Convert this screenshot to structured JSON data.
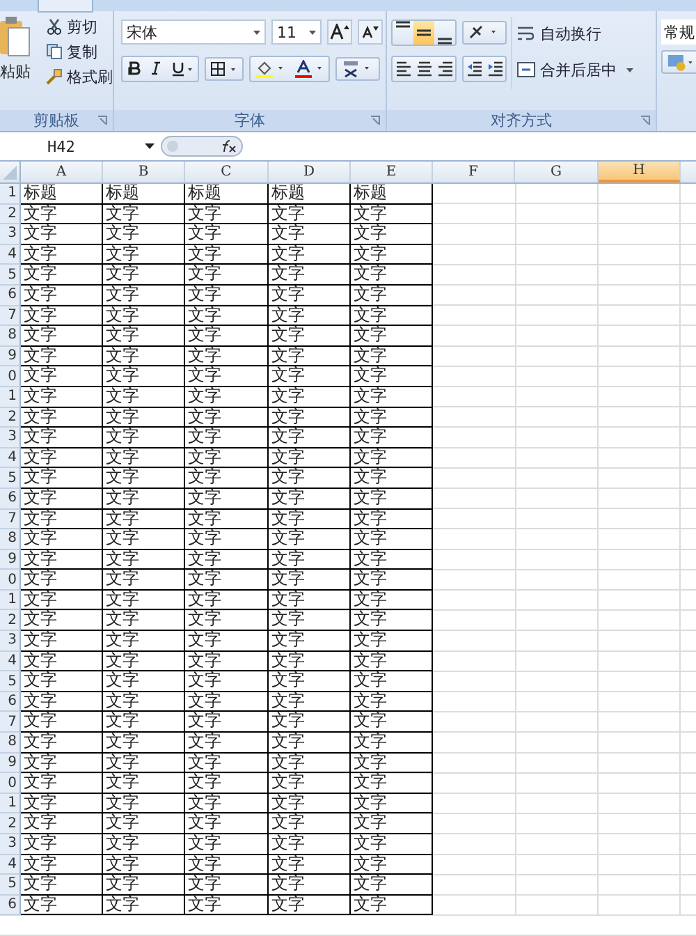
{
  "ribbon": {
    "clipboard": {
      "paste": "粘贴",
      "buttons": [
        {
          "kind": "cut",
          "label": "剪切"
        },
        {
          "kind": "copy",
          "label": "复制"
        },
        {
          "kind": "painter",
          "label": "格式刷"
        }
      ],
      "label": "剪贴板"
    },
    "font": {
      "family": "宋体",
      "size": "11",
      "label": "字体"
    },
    "alignment": {
      "vertical": [
        {
          "kind": "top",
          "selected": false
        },
        {
          "kind": "middle",
          "selected": true
        },
        {
          "kind": "bottom",
          "selected": false
        }
      ],
      "wrap": "自动换行",
      "merge": "合并后居中",
      "label": "对齐方式"
    },
    "number": {
      "format": "常规"
    }
  },
  "formula_bar": {
    "name_box": "H42"
  },
  "columns": [
    {
      "label": "A",
      "selected": false
    },
    {
      "label": "B",
      "selected": false
    },
    {
      "label": "C",
      "selected": false
    },
    {
      "label": "D",
      "selected": false
    },
    {
      "label": "E",
      "selected": false
    },
    {
      "label": "F",
      "selected": false
    },
    {
      "label": "G",
      "selected": false
    },
    {
      "label": "H",
      "selected": true
    }
  ],
  "rows": [
    {
      "number": "1",
      "cells": [
        "标题",
        "标题",
        "标题",
        "标题",
        "标题"
      ]
    },
    {
      "number": "2",
      "cells": [
        "文字",
        "文字",
        "文字",
        "文字",
        "文字"
      ]
    },
    {
      "number": "3",
      "cells": [
        "文字",
        "文字",
        "文字",
        "文字",
        "文字"
      ]
    },
    {
      "number": "4",
      "cells": [
        "文字",
        "文字",
        "文字",
        "文字",
        "文字"
      ]
    },
    {
      "number": "5",
      "cells": [
        "文字",
        "文字",
        "文字",
        "文字",
        "文字"
      ]
    },
    {
      "number": "6",
      "cells": [
        "文字",
        "文字",
        "文字",
        "文字",
        "文字"
      ]
    },
    {
      "number": "7",
      "cells": [
        "文字",
        "文字",
        "文字",
        "文字",
        "文字"
      ]
    },
    {
      "number": "8",
      "cells": [
        "文字",
        "文字",
        "文字",
        "文字",
        "文字"
      ]
    },
    {
      "number": "9",
      "cells": [
        "文字",
        "文字",
        "文字",
        "文字",
        "文字"
      ]
    },
    {
      "number": "0",
      "cells": [
        "文字",
        "文字",
        "文字",
        "文字",
        "文字"
      ]
    },
    {
      "number": "1",
      "cells": [
        "文字",
        "文字",
        "文字",
        "文字",
        "文字"
      ]
    },
    {
      "number": "2",
      "cells": [
        "文字",
        "文字",
        "文字",
        "文字",
        "文字"
      ]
    },
    {
      "number": "3",
      "cells": [
        "文字",
        "文字",
        "文字",
        "文字",
        "文字"
      ]
    },
    {
      "number": "4",
      "cells": [
        "文字",
        "文字",
        "文字",
        "文字",
        "文字"
      ]
    },
    {
      "number": "5",
      "cells": [
        "文字",
        "文字",
        "文字",
        "文字",
        "文字"
      ]
    },
    {
      "number": "6",
      "cells": [
        "文字",
        "文字",
        "文字",
        "文字",
        "文字"
      ]
    },
    {
      "number": "7",
      "cells": [
        "文字",
        "文字",
        "文字",
        "文字",
        "文字"
      ]
    },
    {
      "number": "8",
      "cells": [
        "文字",
        "文字",
        "文字",
        "文字",
        "文字"
      ]
    },
    {
      "number": "9",
      "cells": [
        "文字",
        "文字",
        "文字",
        "文字",
        "文字"
      ]
    },
    {
      "number": "0",
      "cells": [
        "文字",
        "文字",
        "文字",
        "文字",
        "文字"
      ]
    },
    {
      "number": "1",
      "cells": [
        "文字",
        "文字",
        "文字",
        "文字",
        "文字"
      ]
    },
    {
      "number": "2",
      "cells": [
        "文字",
        "文字",
        "文字",
        "文字",
        "文字"
      ]
    },
    {
      "number": "3",
      "cells": [
        "文字",
        "文字",
        "文字",
        "文字",
        "文字"
      ]
    },
    {
      "number": "4",
      "cells": [
        "文字",
        "文字",
        "文字",
        "文字",
        "文字"
      ]
    },
    {
      "number": "5",
      "cells": [
        "文字",
        "文字",
        "文字",
        "文字",
        "文字"
      ]
    },
    {
      "number": "6",
      "cells": [
        "文字",
        "文字",
        "文字",
        "文字",
        "文字"
      ]
    },
    {
      "number": "7",
      "cells": [
        "文字",
        "文字",
        "文字",
        "文字",
        "文字"
      ]
    },
    {
      "number": "8",
      "cells": [
        "文字",
        "文字",
        "文字",
        "文字",
        "文字"
      ]
    },
    {
      "number": "9",
      "cells": [
        "文字",
        "文字",
        "文字",
        "文字",
        "文字"
      ]
    },
    {
      "number": "0",
      "cells": [
        "文字",
        "文字",
        "文字",
        "文字",
        "文字"
      ]
    },
    {
      "number": "1",
      "cells": [
        "文字",
        "文字",
        "文字",
        "文字",
        "文字"
      ]
    },
    {
      "number": "2",
      "cells": [
        "文字",
        "文字",
        "文字",
        "文字",
        "文字"
      ]
    },
    {
      "number": "3",
      "cells": [
        "文字",
        "文字",
        "文字",
        "文字",
        "文字"
      ]
    },
    {
      "number": "4",
      "cells": [
        "文字",
        "文字",
        "文字",
        "文字",
        "文字"
      ]
    },
    {
      "number": "5",
      "cells": [
        "文字",
        "文字",
        "文字",
        "文字",
        "文字"
      ]
    },
    {
      "number": "6",
      "cells": [
        "文字",
        "文字",
        "文字",
        "文字",
        "文字"
      ]
    }
  ]
}
